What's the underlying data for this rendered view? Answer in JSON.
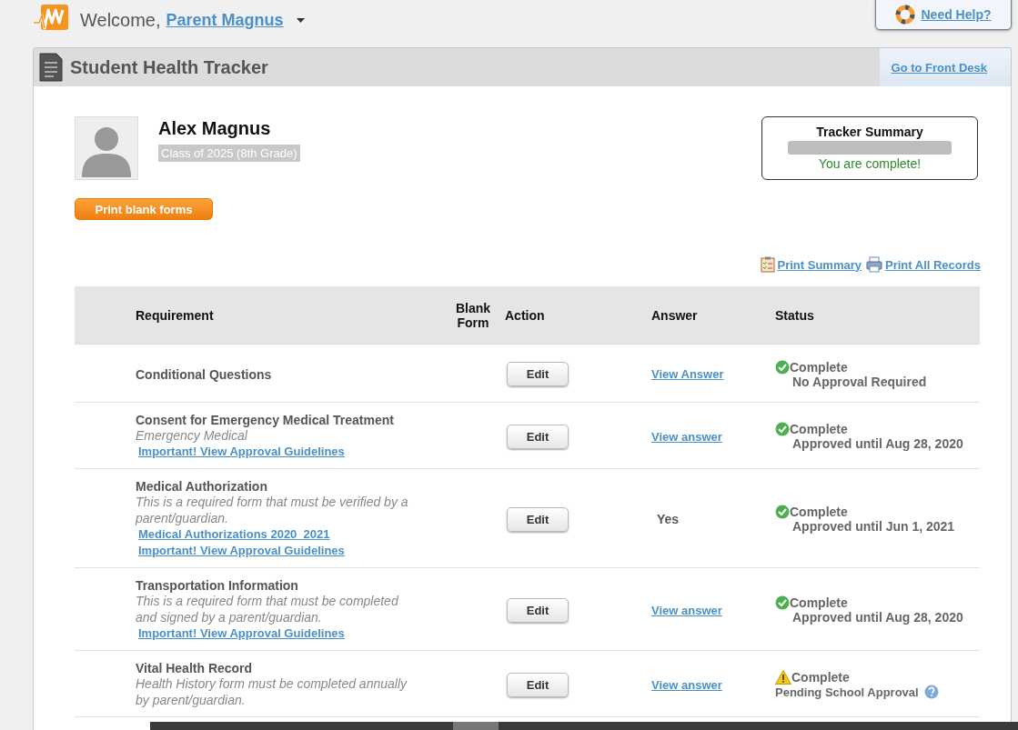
{
  "header": {
    "welcome": "Welcome,",
    "user": "Parent Magnus",
    "help": "Need Help?"
  },
  "panel": {
    "title": "Student Health Tracker",
    "front_desk": "Go to Front Desk"
  },
  "student": {
    "name": "Alex Magnus",
    "class": "Class of 2025 (8th Grade)"
  },
  "print_blank": "Print blank forms",
  "tracker": {
    "title": "Tracker Summary",
    "level": 1,
    "message": "You are complete!"
  },
  "print_links": [
    {
      "kind": "clipboard",
      "label": "Print Summary"
    },
    {
      "kind": "printer",
      "label": "Print All Records"
    }
  ],
  "table": {
    "columns": [
      "Requirement",
      "Blank Form",
      "Action",
      "Answer",
      "Status"
    ],
    "rows": [
      {
        "name": "Conditional Questions",
        "action": "Edit",
        "answer": {
          "kind": "link",
          "text": "View Answer"
        },
        "status": {
          "kind": "check",
          "label": "Complete",
          "detail": "No Approval Required"
        }
      },
      {
        "name": "Consent for Emergency Medical Treatment",
        "description": "Emergency Medical",
        "links": [
          "Important! View Approval Guidelines"
        ],
        "action": "Edit",
        "answer": {
          "kind": "link",
          "text": "View answer"
        },
        "status": {
          "kind": "check",
          "label": "Complete",
          "detail": "Approved until Aug 28, 2020"
        }
      },
      {
        "name": "Medical Authorization",
        "description": "This is a required form that must be verified by a parent/guardian.",
        "links": [
          "Medical Authorizations 2020_2021",
          "Important! View Approval Guidelines"
        ],
        "action": "Edit",
        "answer": {
          "kind": "text",
          "text": "Yes"
        },
        "status": {
          "kind": "check",
          "label": "Complete",
          "detail": "Approved until Jun 1, 2021"
        }
      },
      {
        "name": "Transportation Information",
        "description": "This is a required form that must be completed and signed by a parent/guardian.",
        "links": [
          "Important! View Approval Guidelines"
        ],
        "action": "Edit",
        "answer": {
          "kind": "link",
          "text": "View answer"
        },
        "status": {
          "kind": "check",
          "label": "Complete",
          "detail": "Approved until Aug 28, 2020"
        }
      },
      {
        "name": "Vital Health Record",
        "description": "Health History form must be completed annually by parent/guardian.",
        "action": "Edit",
        "answer": {
          "kind": "link",
          "text": "View answer"
        },
        "status": {
          "kind": "warning",
          "label": "Complete",
          "detail": "Pending School Approval",
          "help": true
        }
      }
    ]
  }
}
